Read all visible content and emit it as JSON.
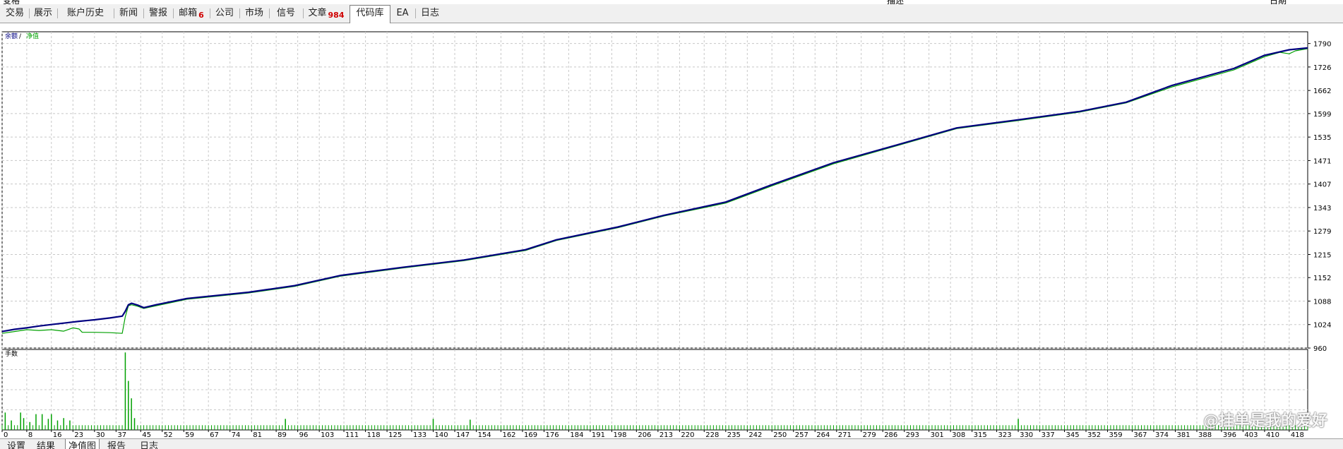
{
  "top_strip": [
    "变格",
    "描述",
    "日期"
  ],
  "tabs": [
    {
      "label": "交易"
    },
    {
      "label": "展示"
    },
    {
      "label": "账户历史"
    },
    {
      "label": "新闻"
    },
    {
      "label": "警报"
    },
    {
      "label": "邮箱",
      "badge": "6"
    },
    {
      "label": "公司"
    },
    {
      "label": "市场"
    },
    {
      "label": "信号"
    },
    {
      "label": "文章",
      "badge": "984"
    },
    {
      "label": "代码库",
      "active": true
    },
    {
      "label": "EA"
    },
    {
      "label": "日志"
    }
  ],
  "bottom_tabs": [
    {
      "label": "设置"
    },
    {
      "label": "结果"
    },
    {
      "label": "净值图",
      "active": true
    },
    {
      "label": "报告"
    },
    {
      "label": "日志"
    }
  ],
  "watermark": "@挂单是我的爱好",
  "colors": {
    "balance": "#000080",
    "equity": "#00a000",
    "volume": "#00a000",
    "grid": "#c8c8c8"
  },
  "chart_data": [
    {
      "type": "line",
      "legend": {
        "balance": "余额",
        "sep": " / ",
        "equity": "净值"
      },
      "ylim": [
        960,
        1822
      ],
      "y_ticks": [
        960,
        1024,
        1088,
        1152,
        1215,
        1279,
        1343,
        1407,
        1471,
        1535,
        1599,
        1662,
        1726,
        1790
      ],
      "xlim": [
        0,
        424
      ],
      "x_ticks": [
        0,
        8,
        16,
        23,
        30,
        37,
        45,
        52,
        59,
        67,
        74,
        81,
        89,
        96,
        103,
        111,
        118,
        125,
        133,
        140,
        147,
        154,
        162,
        169,
        176,
        184,
        191,
        198,
        206,
        213,
        220,
        228,
        235,
        242,
        250,
        257,
        264,
        271,
        279,
        286,
        293,
        301,
        308,
        315,
        323,
        330,
        337,
        345,
        352,
        359,
        367,
        374,
        381,
        388,
        396,
        403,
        410,
        418
      ],
      "series": [
        {
          "key": "balance",
          "x": [
            0,
            4,
            8,
            12,
            16,
            20,
            25,
            30,
            35,
            39,
            40,
            41,
            42,
            44,
            46,
            50,
            60,
            80,
            95,
            110,
            130,
            150,
            170,
            180,
            200,
            215,
            235,
            250,
            270,
            290,
            310,
            330,
            350,
            365,
            380,
            400,
            410,
            418,
            424
          ],
          "y": [
            1005,
            1011,
            1015,
            1020,
            1024,
            1028,
            1033,
            1037,
            1042,
            1047,
            1060,
            1078,
            1082,
            1077,
            1070,
            1078,
            1095,
            1112,
            1130,
            1158,
            1180,
            1200,
            1228,
            1255,
            1290,
            1322,
            1358,
            1405,
            1465,
            1512,
            1560,
            1582,
            1605,
            1630,
            1676,
            1722,
            1758,
            1773,
            1778
          ]
        },
        {
          "key": "equity",
          "x": [
            0,
            4,
            8,
            12,
            16,
            20,
            23,
            25,
            26,
            30,
            35,
            39,
            40,
            41,
            42,
            44,
            46,
            50,
            60,
            80,
            95,
            110,
            130,
            150,
            170,
            180,
            200,
            215,
            235,
            250,
            270,
            290,
            310,
            330,
            350,
            365,
            380,
            400,
            410,
            415,
            418,
            420,
            424
          ],
          "y": [
            1000,
            1005,
            1010,
            1008,
            1010,
            1006,
            1015,
            1012,
            1003,
            1003,
            1002,
            1000,
            1045,
            1075,
            1078,
            1074,
            1068,
            1075,
            1093,
            1110,
            1128,
            1156,
            1178,
            1198,
            1226,
            1253,
            1288,
            1320,
            1355,
            1402,
            1462,
            1510,
            1558,
            1580,
            1603,
            1628,
            1672,
            1718,
            1754,
            1766,
            1762,
            1770,
            1776
          ]
        }
      ]
    },
    {
      "type": "bar",
      "label": "手数",
      "xlim": [
        0,
        424
      ],
      "spikes": [
        [
          1,
          0.22
        ],
        [
          3,
          0.12
        ],
        [
          6,
          0.22
        ],
        [
          7,
          0.15
        ],
        [
          9,
          0.1
        ],
        [
          11,
          0.2
        ],
        [
          13,
          0.2
        ],
        [
          15,
          0.14
        ],
        [
          16,
          0.2
        ],
        [
          18,
          0.12
        ],
        [
          20,
          0.15
        ],
        [
          22,
          0.12
        ],
        [
          40,
          0.98
        ],
        [
          41,
          0.62
        ],
        [
          42,
          0.4
        ],
        [
          43,
          0.15
        ],
        [
          92,
          0.14
        ],
        [
          140,
          0.14
        ],
        [
          152,
          0.13
        ],
        [
          330,
          0.14
        ]
      ],
      "baseline": 0.06
    }
  ]
}
